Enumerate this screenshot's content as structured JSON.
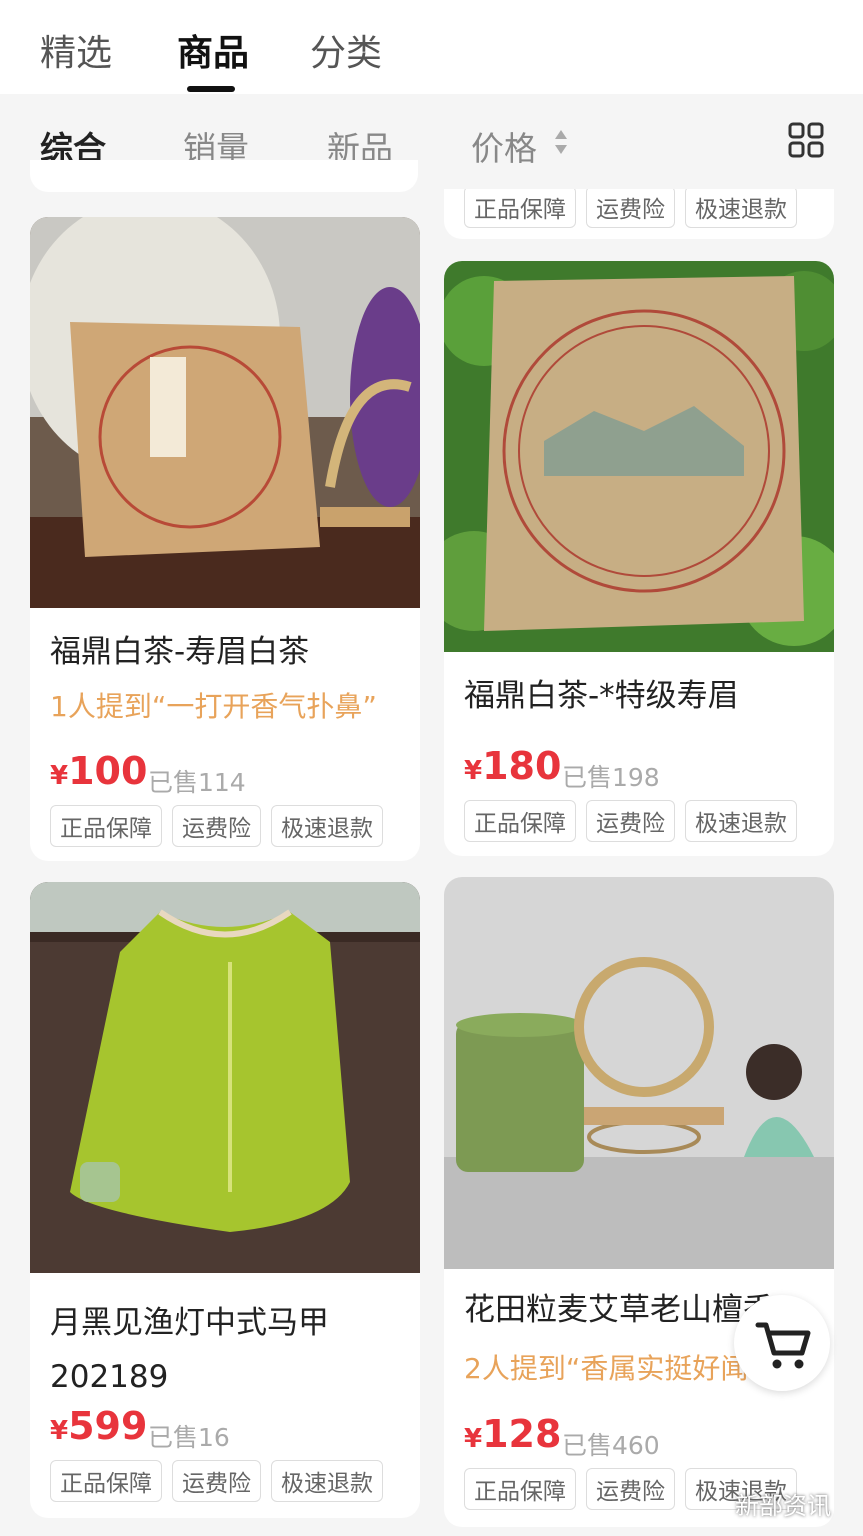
{
  "top_tabs": [
    "精选",
    "商品",
    "分类"
  ],
  "sort_tabs": [
    "综合",
    "销量",
    "新品",
    "价格"
  ],
  "tag_labels": [
    "正品保障",
    "运费险",
    "极速退款"
  ],
  "cards": [
    {
      "title": "福鼎白茶-寿眉白茶",
      "mention": "1人提到“一打开香气扑鼻”",
      "price": "100",
      "sold": "已售114"
    },
    {
      "title": "福鼎白茶-*特级寿眉",
      "price": "180",
      "sold": "已售198"
    },
    {
      "title": "月黑见渔灯中式马甲202189",
      "price": "599",
      "sold": "已售16"
    },
    {
      "title": "花田粒麦艾草老山檀香*",
      "mention": "2人提到“香属实挺好闻”",
      "price": "128",
      "sold": "已售460"
    }
  ],
  "currency": "¥",
  "watermark": "新部资讯",
  "colors": {
    "price": "#e8343c",
    "mention": "#e8a35a"
  },
  "icons": [
    "sort-arrows-icon",
    "grid-view-icon",
    "cart-icon"
  ]
}
